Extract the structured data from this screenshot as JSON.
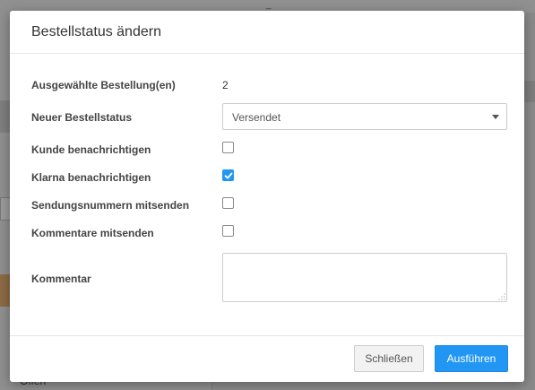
{
  "background": {
    "status_text": "Offen",
    "top_mark": "_"
  },
  "dialog": {
    "title": "Bestellstatus ändern",
    "selected_orders": {
      "label": "Ausgewählte Bestellung(en)",
      "value": "2"
    },
    "new_status": {
      "label": "Neuer Bestellstatus",
      "selected": "Versendet"
    },
    "notify_customer": {
      "label": "Kunde benachrichtigen",
      "checked": false
    },
    "notify_klarna": {
      "label": "Klarna benachrichtigen",
      "checked": true
    },
    "send_tracking": {
      "label": "Sendungsnummern mitsenden",
      "checked": false
    },
    "send_comments": {
      "label": "Kommentare mitsenden",
      "checked": false
    },
    "comment": {
      "label": "Kommentar",
      "value": ""
    },
    "buttons": {
      "close": "Schließen",
      "run": "Ausführen"
    }
  },
  "colors": {
    "primary": "#2196f3",
    "overlay": "#8c8c8c",
    "text": "#333333"
  }
}
